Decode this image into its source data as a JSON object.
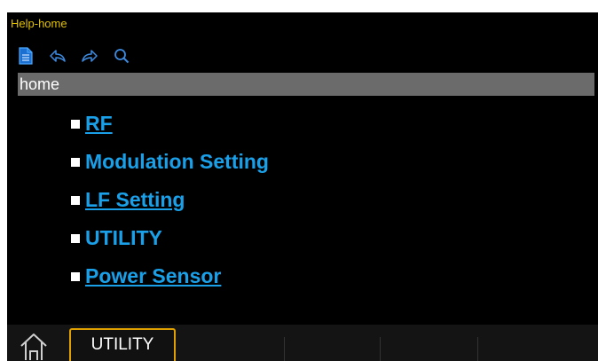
{
  "window": {
    "title": "Help-home"
  },
  "toolbar": {
    "icons": [
      "document-icon",
      "back-icon",
      "forward-icon",
      "search-icon"
    ]
  },
  "address": {
    "path": "home"
  },
  "topics": [
    {
      "label": "RF",
      "underlined": true
    },
    {
      "label": "Modulation Setting",
      "underlined": false
    },
    {
      "label": "LF Setting",
      "underlined": true
    },
    {
      "label": "UTILITY",
      "underlined": false
    },
    {
      "label": "Power Sensor",
      "underlined": true
    }
  ],
  "softkeys": {
    "active_label": "UTILITY"
  },
  "colors": {
    "title": "#e0c000",
    "link": "#1aa0e8",
    "address_bg": "#6b6b6b",
    "softkey_border": "#e0a000"
  }
}
